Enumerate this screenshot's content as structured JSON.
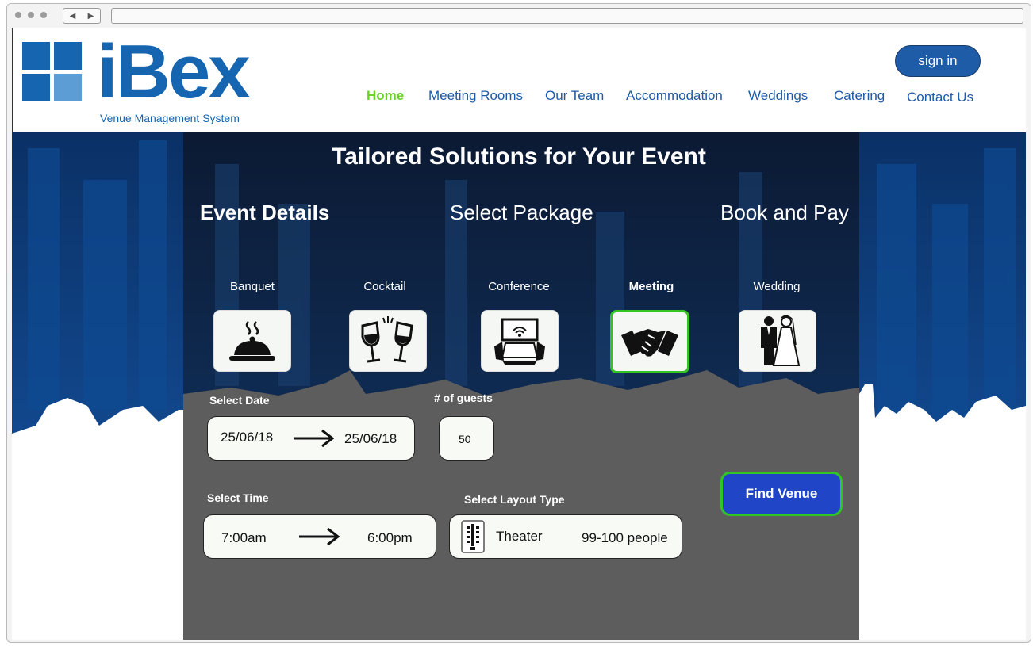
{
  "brand": {
    "name": "iBex",
    "tagline": "Venue Management System",
    "colors": {
      "primary": "#1565b0",
      "light": "#4a8fcf",
      "nav_active": "#6dd12a"
    }
  },
  "nav": {
    "items": [
      {
        "label": "Home",
        "active": true
      },
      {
        "label": "Meeting Rooms"
      },
      {
        "label": "Our Team"
      },
      {
        "label": "Accommodation"
      },
      {
        "label": "Weddings"
      },
      {
        "label": "Catering"
      },
      {
        "label": "Contact Us"
      }
    ],
    "sign_in": "sign in"
  },
  "hero": {
    "title": "Tailored Solutions for Your Event",
    "steps": [
      "Event Details",
      "Select Package",
      "Book and Pay"
    ],
    "current_step": "Event Details"
  },
  "event_types": [
    {
      "label": "Banquet",
      "icon": "cloche-icon"
    },
    {
      "label": "Cocktail",
      "icon": "cheers-glasses-icon"
    },
    {
      "label": "Conference",
      "icon": "conference-table-icon"
    },
    {
      "label": "Meeting",
      "icon": "handshake-icon",
      "selected": true
    },
    {
      "label": "Wedding",
      "icon": "wedding-couple-icon"
    }
  ],
  "form": {
    "date_label": "Select Date",
    "date_from": "25/06/18",
    "date_to": "25/06/18",
    "guests_label": "# of guests",
    "guests": "50",
    "time_label": "Select  Time",
    "time_from": "7:00am",
    "time_to": "6:00pm",
    "layout_label": "Select  Layout Type",
    "layout_name": "Theater",
    "layout_capacity": "99-100 people",
    "find_button": "Find  Venue"
  }
}
